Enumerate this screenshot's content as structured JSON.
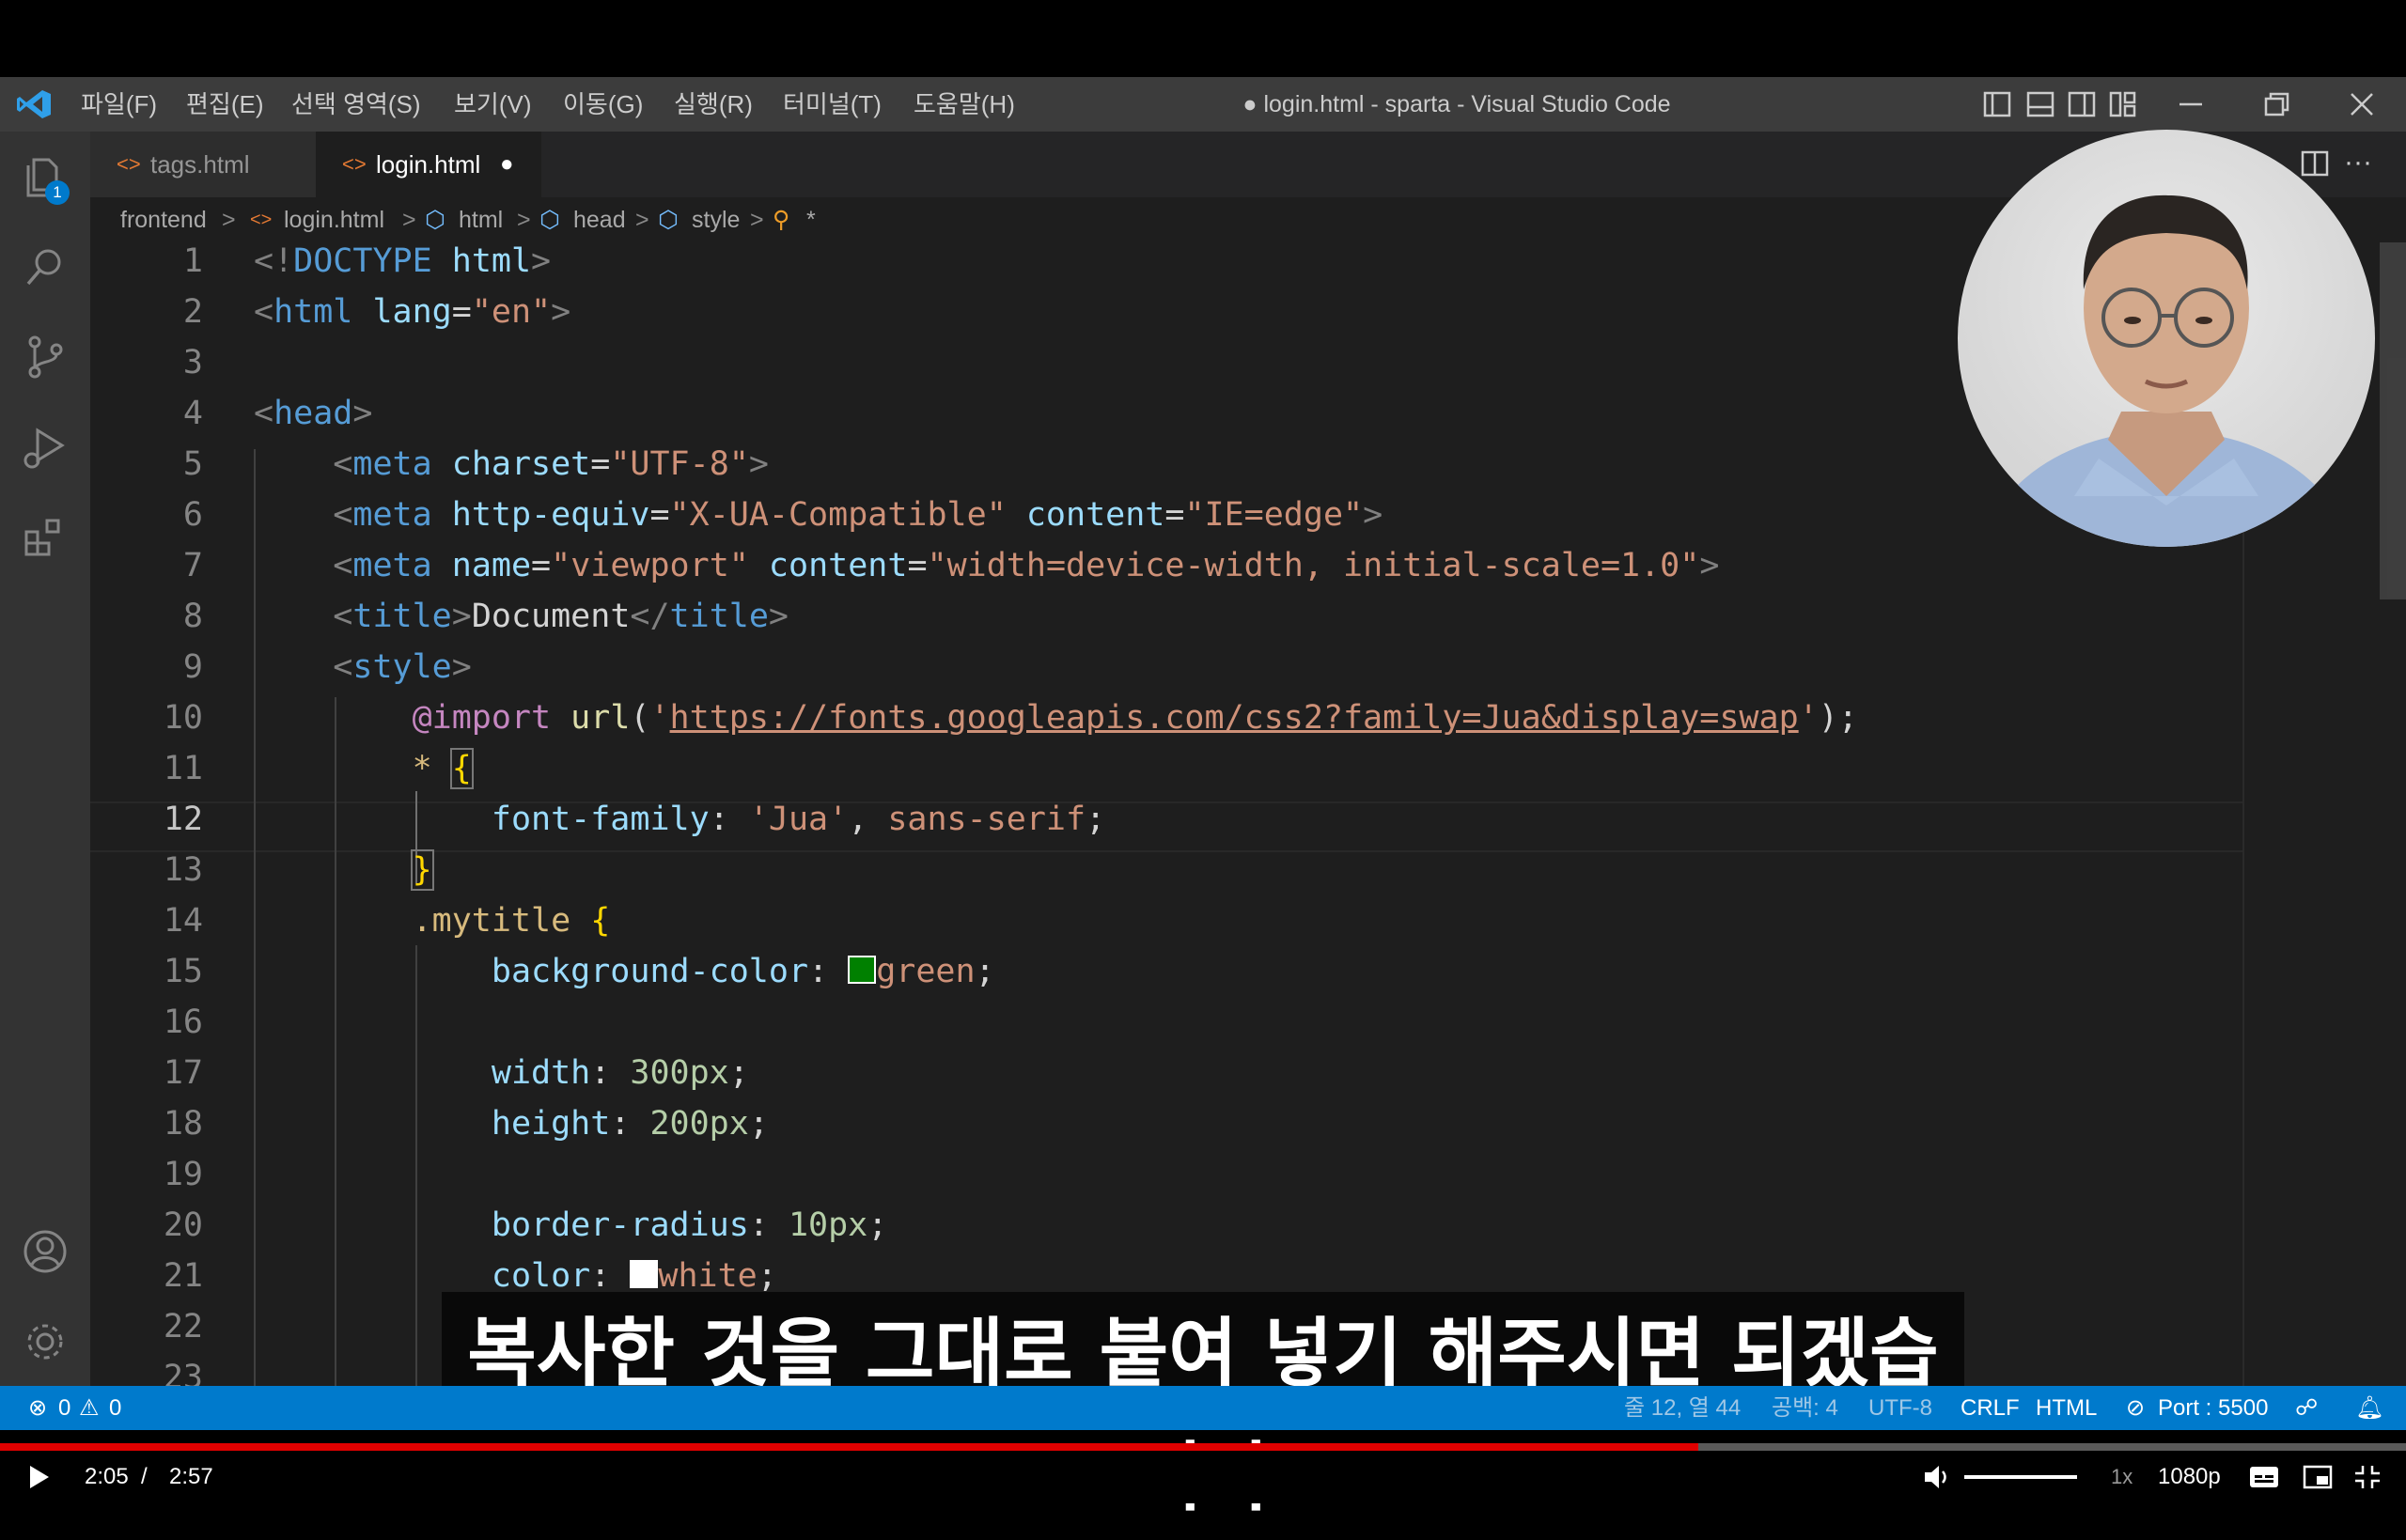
{
  "window": {
    "title": "● login.html - sparta - Visual Studio Code",
    "menu": [
      "파일(F)",
      "편집(E)",
      "선택 영역(S)",
      "보기(V)",
      "이동(G)",
      "실행(R)",
      "터미널(T)",
      "도움말(H)"
    ]
  },
  "activity": {
    "explorer_badge": "1"
  },
  "tabs": [
    {
      "label": "tags.html",
      "active": false
    },
    {
      "label": "login.html",
      "active": true,
      "modified_dot": "●"
    }
  ],
  "breadcrumb": [
    "frontend",
    "login.html",
    "html",
    "head",
    "style",
    "*"
  ],
  "editor": {
    "active_line": 12,
    "line_numbers": [
      "1",
      "2",
      "3",
      "4",
      "5",
      "6",
      "7",
      "8",
      "9",
      "10",
      "11",
      "12",
      "13",
      "14",
      "15",
      "16",
      "17",
      "18",
      "19",
      "20",
      "21",
      "22",
      "23"
    ]
  },
  "status": {
    "errors": "0",
    "warnings": "0",
    "position": "줄 12, 열 44",
    "spaces": "공백: 4",
    "encoding": "UTF-8",
    "eol": "CRLF",
    "language": "HTML",
    "port": "Port : 5500"
  },
  "subtitle": "복사한 것을 그대로 붙여 넣기 해주시면 되겠습니다",
  "player": {
    "time_current": "2:05",
    "time_sep": "/",
    "time_total": "2:57",
    "progress": 0.706,
    "speed": "1x",
    "quality": "1080p"
  },
  "colors": {
    "statusbar": "#007acc",
    "progress": "#e00000",
    "editor_bg": "#1e1e1e"
  }
}
